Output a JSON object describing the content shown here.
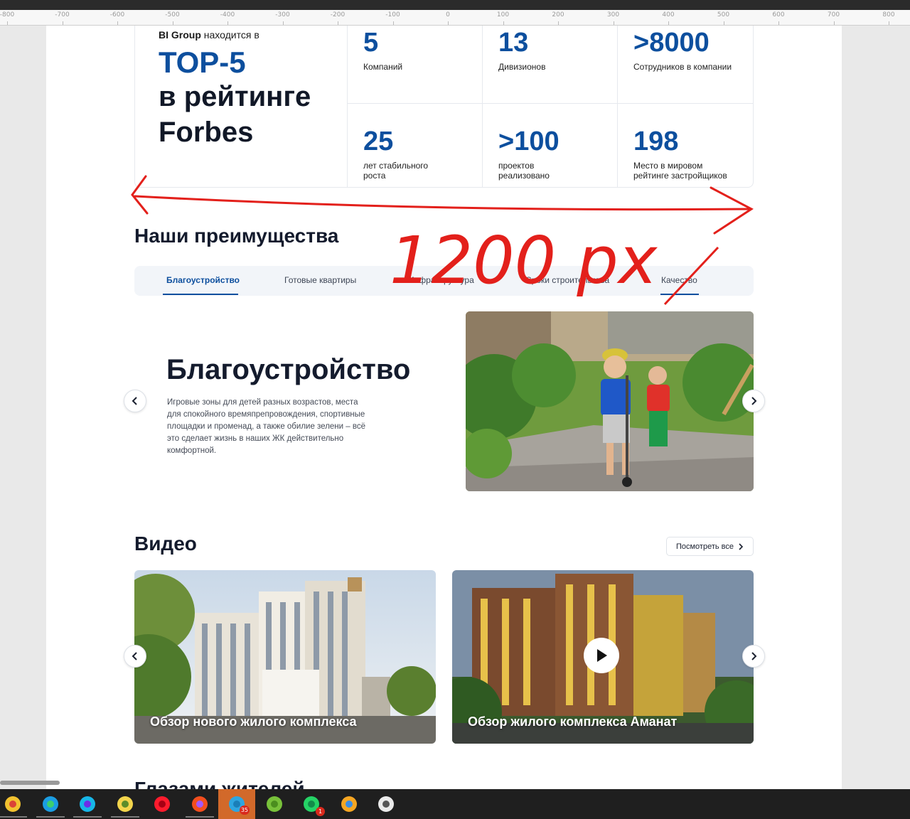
{
  "ruler": {
    "ticks": [
      "-800",
      "-700",
      "-600",
      "-500",
      "-400",
      "-300",
      "-200",
      "-100",
      "0",
      "100",
      "200",
      "300",
      "400",
      "500",
      "600",
      "700",
      "800"
    ]
  },
  "stats": {
    "intro_brand": "BI Group",
    "intro_text": " находится в",
    "top5": "ТОP-5",
    "rating_text": "в рейтинге\nForbes",
    "items": [
      {
        "value": "5",
        "label": "Компаний"
      },
      {
        "value": "13",
        "label": "Дивизионов"
      },
      {
        "value": ">8000",
        "label": "Сотрудников в компании"
      },
      {
        "value": "25",
        "label": "лет стабильного\nроста"
      },
      {
        "value": ">100",
        "label": "проектов\nреализовано"
      },
      {
        "value": "198",
        "label": "Место в мировом\nрейтинге застройщиков"
      }
    ]
  },
  "annotation": {
    "text": "1200 px",
    "color": "#e3201b"
  },
  "advantages": {
    "heading": "Наши преимущества",
    "tabs": [
      {
        "label": "Благоустройство",
        "active": true
      },
      {
        "label": "Готовые квартиры",
        "active": false
      },
      {
        "label": "Инфраструктура",
        "active": false
      },
      {
        "label": "Сроки строительства",
        "active": false
      },
      {
        "label": "Качество",
        "active": false
      }
    ],
    "slide_title": "Благоустройство",
    "slide_text": "Игровые зоны для детей разных возрастов, места для спокойного времяпрепровождения, спортивные площадки и променад, а также обилие зелени – всё это сделает жизнь в наших ЖК действительно комфортной."
  },
  "video": {
    "heading": "Видео",
    "view_all": "Посмотреть все",
    "cards": [
      {
        "caption": "Обзор нового жилого комплекса"
      },
      {
        "caption": "Обзор жилого комплекса Аманат"
      }
    ]
  },
  "next_section_heading": "Глазами жителей",
  "taskbar": {
    "apps": [
      {
        "icon": "chrome-icon"
      },
      {
        "icon": "edge-icon"
      },
      {
        "icon": "webstorm-icon"
      },
      {
        "icon": "image-viewer-icon"
      },
      {
        "icon": "opera-icon"
      },
      {
        "icon": "figma-icon"
      },
      {
        "icon": "telegram-icon",
        "badge": "35"
      },
      {
        "icon": "utorrent-icon"
      },
      {
        "icon": "whatsapp-icon",
        "badge": "1"
      },
      {
        "icon": "media-player-icon"
      },
      {
        "icon": "photos-icon"
      }
    ]
  },
  "colors": {
    "brand_blue": "#0d4f9e",
    "heading": "#141b2d"
  }
}
